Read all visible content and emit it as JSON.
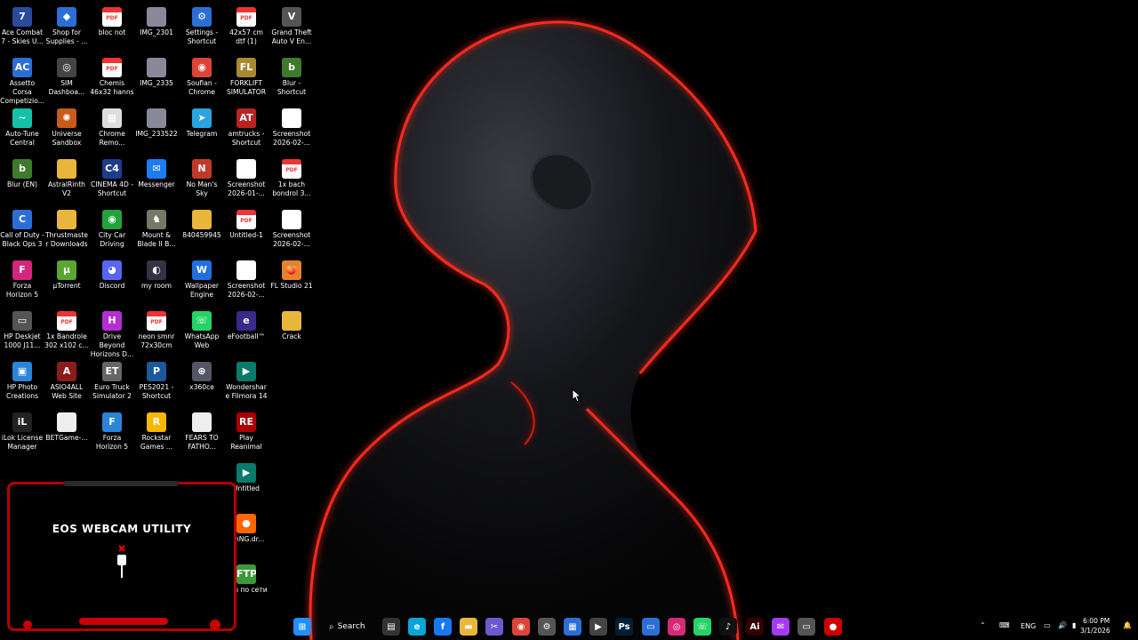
{
  "desktop": {
    "icons": [
      {
        "col": 0,
        "row": 0,
        "label": "Ace Combat 7 - Skies U...",
        "icon": "ace-combat-icon",
        "color": "#2a4b9b",
        "glyph": "7"
      },
      {
        "col": 0,
        "row": 1,
        "label": "Assetto Corsa Competizio...",
        "icon": "assetto-corsa-icon",
        "color": "#2b6fd6",
        "glyph": "AC"
      },
      {
        "col": 0,
        "row": 2,
        "label": "Auto-Tune Central",
        "icon": "autotune-icon",
        "color": "#15c2a7",
        "glyph": "~"
      },
      {
        "col": 0,
        "row": 3,
        "label": "Blur (EN)",
        "icon": "blur-icon",
        "color": "#3e7a2c",
        "glyph": "b"
      },
      {
        "col": 0,
        "row": 4,
        "label": "Call of Duty - Black Ops 3",
        "icon": "cod-icon",
        "color": "#2b6fd6",
        "glyph": "C"
      },
      {
        "col": 0,
        "row": 5,
        "label": "Forza Horizon 5",
        "icon": "forza-horizon-icon",
        "color": "#d4267c",
        "glyph": "F"
      },
      {
        "col": 0,
        "row": 6,
        "label": "HP Deskjet 1000 J11...",
        "icon": "printer-icon",
        "color": "#555",
        "glyph": "▭"
      },
      {
        "col": 0,
        "row": 7,
        "label": "HP Photo Creations",
        "icon": "hp-photo-icon",
        "color": "#2a85d8",
        "glyph": "▣"
      },
      {
        "col": 0,
        "row": 8,
        "label": "iLok License Manager",
        "icon": "ilok-icon",
        "color": "#222",
        "glyph": "iL"
      },
      {
        "col": 1,
        "row": 0,
        "label": "Shop for Supplies - ...",
        "icon": "shop-supplies-icon",
        "color": "#2b6fd6",
        "glyph": "◆"
      },
      {
        "col": 1,
        "row": 1,
        "label": "SIM Dashboa...",
        "icon": "sim-dashboard-icon",
        "color": "#444",
        "glyph": "◎"
      },
      {
        "col": 1,
        "row": 2,
        "label": "Universe Sandbox",
        "icon": "universe-sandbox-icon",
        "color": "#c65b1b",
        "glyph": "✺"
      },
      {
        "col": 1,
        "row": 3,
        "label": "AstralRinth V2",
        "icon": "folder-icon",
        "color": "#e8b63a",
        "glyph": ""
      },
      {
        "col": 1,
        "row": 4,
        "label": "Thrustmaster Downloads",
        "icon": "folder-icon",
        "color": "#e8b63a",
        "glyph": ""
      },
      {
        "col": 1,
        "row": 5,
        "label": "µTorrent",
        "icon": "utorrent-icon",
        "color": "#5aa62e",
        "glyph": "µ"
      },
      {
        "col": 1,
        "row": 6,
        "label": "1x Bandrole 302 x102 c...",
        "icon": "pdf-icon",
        "color": "#e33",
        "glyph": "PDF"
      },
      {
        "col": 1,
        "row": 7,
        "label": "ASIO4ALL Web Site",
        "icon": "asio-icon",
        "color": "#8b1c1c",
        "glyph": "A"
      },
      {
        "col": 1,
        "row": 8,
        "label": "BETGame-...",
        "icon": "file-icon",
        "color": "#eee",
        "glyph": ""
      },
      {
        "col": 2,
        "row": 0,
        "label": "bloc not",
        "icon": "pdf-icon",
        "color": "#e33",
        "glyph": "PDF"
      },
      {
        "col": 2,
        "row": 1,
        "label": "Chemis 46x32 hanns",
        "icon": "pdf-icon",
        "color": "#e33",
        "glyph": "PDF"
      },
      {
        "col": 2,
        "row": 2,
        "label": "Chrome Remo...",
        "icon": "chrome-remote-icon",
        "color": "#ddd",
        "glyph": "▦"
      },
      {
        "col": 2,
        "row": 3,
        "label": "CINEMA 4D - Shortcut",
        "icon": "cinema4d-icon",
        "color": "#1d3c8c",
        "glyph": "C4"
      },
      {
        "col": 2,
        "row": 4,
        "label": "City Car Driving",
        "icon": "city-car-icon",
        "color": "#22a33a",
        "glyph": "◉"
      },
      {
        "col": 2,
        "row": 5,
        "label": "Discord",
        "icon": "discord-icon",
        "color": "#5865f2",
        "glyph": "◕"
      },
      {
        "col": 2,
        "row": 6,
        "label": "Drive Beyond Horizons D...",
        "icon": "drive-beyond-icon",
        "color": "#b62ed1",
        "glyph": "H"
      },
      {
        "col": 2,
        "row": 7,
        "label": "Euro Truck Simulator 2",
        "icon": "ets2-icon",
        "color": "#666",
        "glyph": "ET"
      },
      {
        "col": 2,
        "row": 8,
        "label": "Forza Horizon 5",
        "icon": "forza-horizon-icon",
        "color": "#2a85d8",
        "glyph": "F"
      },
      {
        "col": 3,
        "row": 0,
        "label": "IMG_2301",
        "icon": "image-icon",
        "color": "#889",
        "glyph": ""
      },
      {
        "col": 3,
        "row": 1,
        "label": "IMG_2335",
        "icon": "image-icon",
        "color": "#889",
        "glyph": ""
      },
      {
        "col": 3,
        "row": 2,
        "label": "IMG_233522",
        "icon": "image-icon",
        "color": "#889",
        "glyph": ""
      },
      {
        "col": 3,
        "row": 3,
        "label": "Messenger",
        "icon": "messenger-icon",
        "color": "#1e7cf2",
        "glyph": "✉"
      },
      {
        "col": 3,
        "row": 4,
        "label": "Mount & Blade II B...",
        "icon": "mount-blade-icon",
        "color": "#776",
        "glyph": "♞"
      },
      {
        "col": 3,
        "row": 5,
        "label": "my room",
        "icon": "my-room-icon",
        "color": "#334",
        "glyph": "◐"
      },
      {
        "col": 3,
        "row": 6,
        "label": "neon smnr 72x30cm",
        "icon": "pdf-icon",
        "color": "#e33",
        "glyph": "PDF"
      },
      {
        "col": 3,
        "row": 7,
        "label": "PES2021 - Shortcut",
        "icon": "pes-icon",
        "color": "#1a5a9a",
        "glyph": "P"
      },
      {
        "col": 3,
        "row": 8,
        "label": "Rockstar Games ...",
        "icon": "rockstar-icon",
        "color": "#f5b800",
        "glyph": "R"
      },
      {
        "col": 4,
        "row": 0,
        "label": "Settings - Shortcut",
        "icon": "settings-shortcut-icon",
        "color": "#2b6fd6",
        "glyph": "⚙"
      },
      {
        "col": 4,
        "row": 1,
        "label": "Soufian - Chrome",
        "icon": "chrome-icon",
        "color": "#db4437",
        "glyph": "◉"
      },
      {
        "col": 4,
        "row": 2,
        "label": "Telegram",
        "icon": "telegram-icon",
        "color": "#2aa3e0",
        "glyph": "➤"
      },
      {
        "col": 4,
        "row": 3,
        "label": "No Man's Sky",
        "icon": "no-mans-sky-icon",
        "color": "#c0392b",
        "glyph": "N"
      },
      {
        "col": 4,
        "row": 4,
        "label": "840459945",
        "icon": "folder-icon",
        "color": "#e8b63a",
        "glyph": ""
      },
      {
        "col": 4,
        "row": 5,
        "label": "Wallpaper Engine",
        "icon": "wallpaper-engine-icon",
        "color": "#1f6fe0",
        "glyph": "W"
      },
      {
        "col": 4,
        "row": 6,
        "label": "WhatsApp Web",
        "icon": "whatsapp-icon",
        "color": "#25d366",
        "glyph": "☏"
      },
      {
        "col": 4,
        "row": 7,
        "label": "x360ce",
        "icon": "gamepad-icon",
        "color": "#556",
        "glyph": "⊕"
      },
      {
        "col": 4,
        "row": 8,
        "label": "FEARS TO FATHO...",
        "icon": "file-icon",
        "color": "#eee",
        "glyph": ""
      },
      {
        "col": 5,
        "row": 0,
        "label": "42x57 cm dtf (1)",
        "icon": "pdf-icon",
        "color": "#e33",
        "glyph": "PDF"
      },
      {
        "col": 5,
        "row": 1,
        "label": "FORKLIFT SIMULATOR",
        "icon": "forklift-icon",
        "color": "#a83",
        "glyph": "FL"
      },
      {
        "col": 5,
        "row": 2,
        "label": "amtrucks - Shortcut",
        "icon": "amtrucks-icon",
        "color": "#b22",
        "glyph": "AT"
      },
      {
        "col": 5,
        "row": 3,
        "label": "Screenshot 2026-01-...",
        "icon": "screenshot-icon",
        "color": "#fff",
        "glyph": ""
      },
      {
        "col": 5,
        "row": 4,
        "label": "Untitled-1",
        "icon": "pdf-icon",
        "color": "#e33",
        "glyph": "PDF"
      },
      {
        "col": 5,
        "row": 5,
        "label": "Screenshot 2026-02-...",
        "icon": "screenshot-icon",
        "color": "#fff",
        "glyph": ""
      },
      {
        "col": 5,
        "row": 6,
        "label": "eFootball™",
        "icon": "efootball-icon",
        "color": "#3a2a8a",
        "glyph": "e"
      },
      {
        "col": 5,
        "row": 7,
        "label": "Wondershare Filmora 14",
        "icon": "filmora-icon",
        "color": "#0a7a6a",
        "glyph": "▶"
      },
      {
        "col": 5,
        "row": 8,
        "label": "Play Reanimal",
        "icon": "reanimal-icon",
        "color": "#a00",
        "glyph": "RE"
      },
      {
        "col": 5,
        "row": 9,
        "label": "Untitled",
        "icon": "filmora-icon",
        "color": "#0a7a6a",
        "glyph": "▶"
      },
      {
        "col": 5,
        "row": 10,
        "label": "amNG.dr...",
        "icon": "beamng-icon",
        "color": "#f60",
        "glyph": "●"
      },
      {
        "col": 5,
        "row": 11,
        "label": "гры по сети",
        "icon": "ftp-icon",
        "color": "#3a9a3a",
        "glyph": "FTP"
      },
      {
        "col": 6,
        "row": 0,
        "label": "Grand Theft Auto V En...",
        "icon": "gta-icon",
        "color": "#555",
        "glyph": "V"
      },
      {
        "col": 6,
        "row": 1,
        "label": "Blur - Shortcut",
        "icon": "blur-icon",
        "color": "#3e7a2c",
        "glyph": "b"
      },
      {
        "col": 6,
        "row": 2,
        "label": "Screenshot 2026-02-...",
        "icon": "screenshot-icon",
        "color": "#fff",
        "glyph": ""
      },
      {
        "col": 6,
        "row": 3,
        "label": "1x bach bondrol 3...",
        "icon": "pdf-icon",
        "color": "#e33",
        "glyph": "PDF"
      },
      {
        "col": 6,
        "row": 4,
        "label": "Screenshot 2026-02-...",
        "icon": "screenshot-icon",
        "color": "#fff",
        "glyph": ""
      },
      {
        "col": 6,
        "row": 5,
        "label": "FL Studio 21",
        "icon": "fl-studio-icon",
        "color": "#e8822a",
        "glyph": "🍑"
      },
      {
        "col": 6,
        "row": 6,
        "label": "Crack",
        "icon": "folder-icon",
        "color": "#e8b63a",
        "glyph": ""
      }
    ]
  },
  "webcam_widget": {
    "title": "EOS WEBCAM UTILITY",
    "accent": "#b30000"
  },
  "taskbar": {
    "search_label": "Search",
    "apps": [
      {
        "icon": "windows-start-icon",
        "color": "#1e90ff",
        "glyph": "⊞"
      },
      {
        "icon": "task-view-icon",
        "color": "#333",
        "glyph": "▤"
      },
      {
        "icon": "edge-icon",
        "color": "#0aa5d8",
        "glyph": "e"
      },
      {
        "icon": "facebook-icon",
        "color": "#1877f2",
        "glyph": "f"
      },
      {
        "icon": "file-explorer-icon",
        "color": "#e8b63a",
        "glyph": "▬"
      },
      {
        "icon": "snipping-tool-icon",
        "color": "#6a5acd",
        "glyph": "✂"
      },
      {
        "icon": "chrome-icon",
        "color": "#db4437",
        "glyph": "◉"
      },
      {
        "icon": "settings-icon",
        "color": "#555",
        "glyph": "⚙"
      },
      {
        "icon": "store-icon",
        "color": "#2b6fd6",
        "glyph": "▦"
      },
      {
        "icon": "media-player-icon",
        "color": "#444",
        "glyph": "▶"
      },
      {
        "icon": "photoshop-icon",
        "color": "#001e36",
        "glyph": "Ps"
      },
      {
        "icon": "app-window-icon",
        "color": "#2b6fd6",
        "glyph": "▭"
      },
      {
        "icon": "instagram-icon",
        "color": "#d62976",
        "glyph": "◎"
      },
      {
        "icon": "whatsapp-icon",
        "color": "#25d366",
        "glyph": "☏"
      },
      {
        "icon": "tiktok-icon",
        "color": "#111",
        "glyph": "♪"
      },
      {
        "icon": "illustrator-icon",
        "color": "#330000",
        "glyph": "Ai"
      },
      {
        "icon": "messenger-icon",
        "color": "#a63af2",
        "glyph": "✉"
      },
      {
        "icon": "printer-icon",
        "color": "#555",
        "glyph": "▭"
      },
      {
        "icon": "record-icon",
        "color": "#c00",
        "glyph": "●"
      }
    ],
    "tray": {
      "language": "ENG",
      "time": "6:00 PM",
      "date": "3/1/2026"
    }
  }
}
